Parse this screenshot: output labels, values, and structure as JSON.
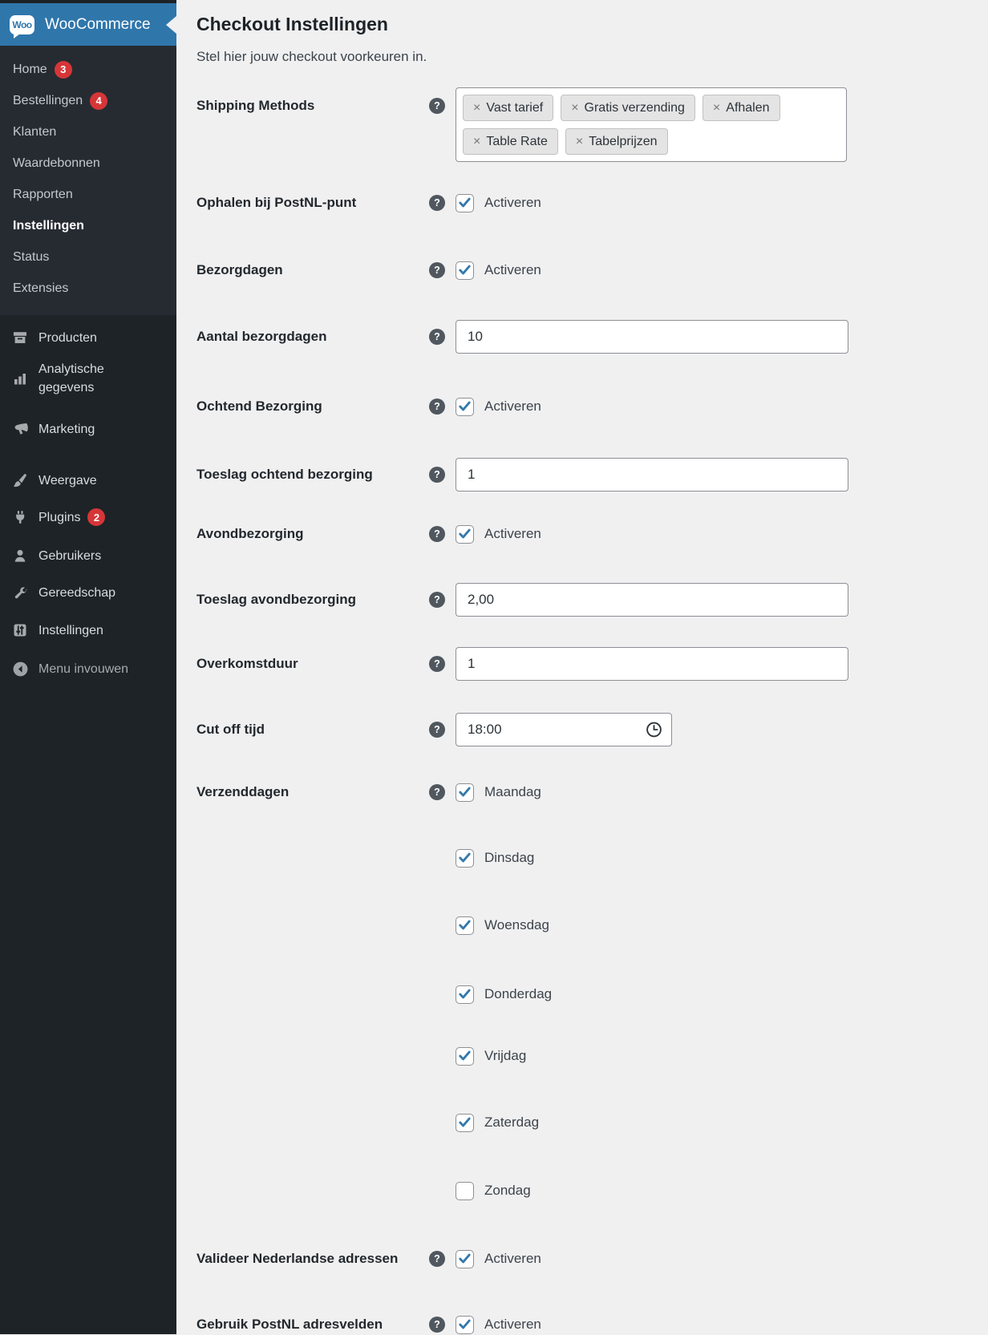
{
  "sidebar": {
    "header": {
      "logo_text": "Woo",
      "title": "WooCommerce"
    },
    "submenu": [
      {
        "label": "Home",
        "badge": "3"
      },
      {
        "label": "Bestellingen",
        "badge": "4"
      },
      {
        "label": "Klanten"
      },
      {
        "label": "Waardebonnen"
      },
      {
        "label": "Rapporten"
      },
      {
        "label": "Instellingen"
      },
      {
        "label": "Status"
      },
      {
        "label": "Extensies"
      }
    ],
    "menu": [
      {
        "label": "Producten"
      },
      {
        "label": "Analytische gegevens"
      },
      {
        "label": "Marketing"
      },
      {
        "label": "Weergave"
      },
      {
        "label": "Plugins",
        "badge": "2"
      },
      {
        "label": "Gebruikers"
      },
      {
        "label": "Gereedschap"
      },
      {
        "label": "Instellingen"
      }
    ],
    "collapse_label": "Menu invouwen"
  },
  "page": {
    "title": "Checkout Instellingen",
    "subtitle": "Stel hier jouw checkout voorkeuren in."
  },
  "ui": {
    "help_glyph": "?",
    "remove_glyph": "×"
  },
  "colors": {
    "accent_blue": "#2f76ab",
    "badge_red": "#d63638",
    "sidebar_dark": "#1d2327",
    "content_bg": "#f0f0f1",
    "check_blue": "#3479ac"
  },
  "form": {
    "shipping_methods": {
      "label": "Shipping Methods",
      "tags": [
        "Vast tarief",
        "Gratis verzending",
        "Afhalen",
        "Table Rate",
        "Tabelprijzen"
      ]
    },
    "pickup_postnl": {
      "label": "Ophalen bij PostNL-punt",
      "checkbox_label": "Activeren",
      "checked": true
    },
    "bezorgdagen": {
      "label": "Bezorgdagen",
      "checkbox_label": "Activeren",
      "checked": true
    },
    "aantal_bezorgdagen": {
      "label": "Aantal bezorgdagen",
      "value": "10"
    },
    "ochtend_bezorging": {
      "label": "Ochtend Bezorging",
      "checkbox_label": "Activeren",
      "checked": true
    },
    "toeslag_ochtend": {
      "label": "Toeslag ochtend bezorging",
      "value": "1"
    },
    "avondbezorging": {
      "label": "Avondbezorging",
      "checkbox_label": "Activeren",
      "checked": true
    },
    "toeslag_avond": {
      "label": "Toeslag avondbezorging",
      "value": "2,00"
    },
    "overkomstduur": {
      "label": "Overkomstduur",
      "value": "1"
    },
    "cutoff_tijd": {
      "label": "Cut off tijd",
      "value": "18:00"
    },
    "verzenddagen": {
      "label": "Verzenddagen",
      "days": [
        {
          "label": "Maandag",
          "checked": true
        },
        {
          "label": "Dinsdag",
          "checked": true
        },
        {
          "label": "Woensdag",
          "checked": true
        },
        {
          "label": "Donderdag",
          "checked": true
        },
        {
          "label": "Vrijdag",
          "checked": true
        },
        {
          "label": "Zaterdag",
          "checked": true
        },
        {
          "label": "Zondag",
          "checked": false
        }
      ]
    },
    "valideer_adressen": {
      "label": "Valideer Nederlandse adressen",
      "checkbox_label": "Activeren",
      "checked": true
    },
    "postnl_adresvelden": {
      "label": "Gebruik PostNL adresvelden",
      "checkbox_label": "Activeren",
      "checked": true
    }
  }
}
